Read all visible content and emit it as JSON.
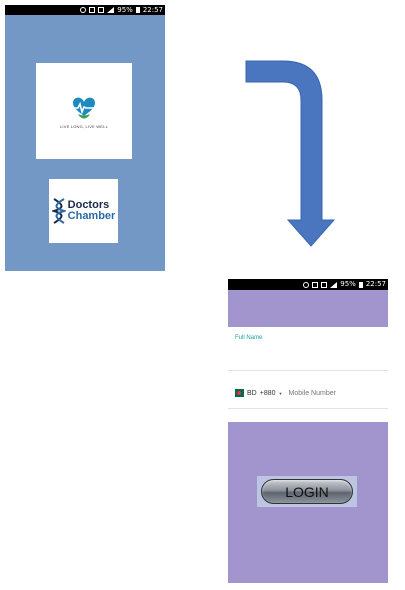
{
  "splash_screen": {
    "status_bar": {
      "battery_percent": "95%",
      "time": "22:57"
    },
    "logo": {
      "tagline": "LIVE LONG, LIVE WELL",
      "heart_color": "#1f8ac0",
      "leaf_color": "#3aa24a"
    },
    "brand": {
      "line1": "Doctors",
      "line2": "Chamber"
    },
    "background_color": "#7398c6"
  },
  "flow_arrow": {
    "icon": "curved-arrow-down-icon",
    "color": "#4a76c0"
  },
  "login_screen": {
    "status_bar": {
      "battery_percent": "95%",
      "time": "22:57"
    },
    "full_name_label": "Full Name",
    "country_code": "BD",
    "dial_code": "+880",
    "mobile_placeholder": "Mobile Number",
    "login_button": "LOGIN",
    "background_color": "#a295cd"
  }
}
